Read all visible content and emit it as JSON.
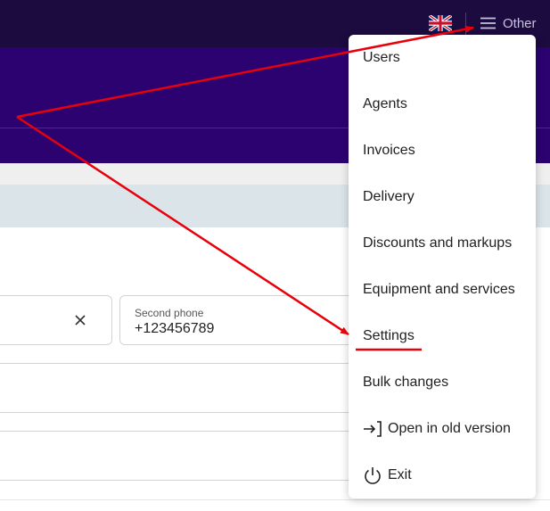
{
  "topbar": {
    "language_icon": "uk-flag-icon",
    "menu_icon": "hamburger-icon",
    "other_label": "Other"
  },
  "form": {
    "second_phone_label": "Second phone",
    "second_phone_value": "+123456789",
    "clear_icon": "close-icon"
  },
  "menu": {
    "items": [
      {
        "label": "Users"
      },
      {
        "label": "Agents"
      },
      {
        "label": "Invoices"
      },
      {
        "label": "Delivery"
      },
      {
        "label": "Discounts and markups"
      },
      {
        "label": "Equipment and services"
      },
      {
        "label": "Settings"
      },
      {
        "label": "Bulk changes"
      },
      {
        "label": "Open in old version",
        "icon": "open-external-icon"
      },
      {
        "label": "Exit",
        "icon": "power-icon"
      }
    ]
  },
  "colors": {
    "topbar": "#1b0b3f",
    "header": "#2c0270",
    "info_band": "#dbe5e9",
    "annotation_red": "#e8000b"
  }
}
